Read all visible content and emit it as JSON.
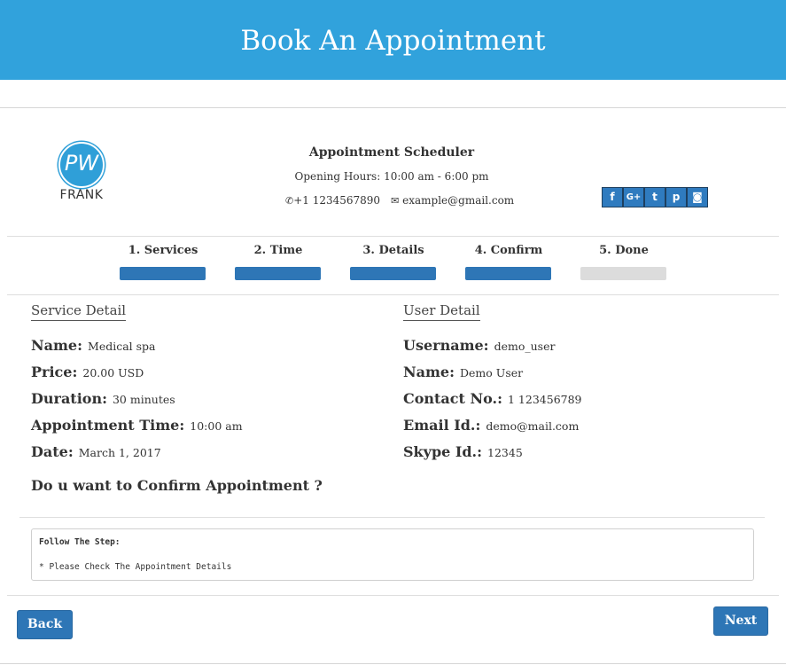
{
  "header": {
    "title": "Book An Appointment"
  },
  "business": {
    "logo_letters": "PW",
    "logo_text": "FRANK",
    "title": "Appointment Scheduler",
    "hours": "Opening Hours: 10:00 am - 6:00 pm",
    "phone": "+1 1234567890",
    "email": "example@gmail.com",
    "social": [
      "facebook-icon",
      "google-plus-icon",
      "twitter-icon",
      "pinterest-icon",
      "instagram-icon"
    ],
    "social_glyphs": {
      "facebook": "f",
      "google": "G+",
      "twitter": "t",
      "pinterest": "p",
      "instagram": "◙"
    }
  },
  "steps": [
    {
      "label": "1. Services",
      "complete": true
    },
    {
      "label": "2. Time",
      "complete": true
    },
    {
      "label": "3. Details",
      "complete": true
    },
    {
      "label": "4. Confirm",
      "complete": true
    },
    {
      "label": "5. Done",
      "complete": false
    }
  ],
  "service_detail": {
    "heading": "Service Detail",
    "name_label": "Name:",
    "name": "Medical spa",
    "price_label": "Price:",
    "price": "20.00 USD",
    "duration_label": "Duration:",
    "duration": "30 minutes",
    "time_label": "Appointment Time:",
    "time": "10:00 am",
    "date_label": "Date:",
    "date": "March 1, 2017"
  },
  "user_detail": {
    "heading": "User Detail",
    "username_label": "Username:",
    "username": "demo_user",
    "name_label": "Name:",
    "name": "Demo User",
    "contact_label": "Contact No.:",
    "contact": "1 123456789",
    "email_label": "Email Id.:",
    "email": "demo@mail.com",
    "skype_label": "Skype Id.:",
    "skype": "12345"
  },
  "confirm_question": "Do u want to Confirm Appointment ?",
  "instructions": {
    "title": "Follow The Step:",
    "line1": "* Please Check The Appointment Details"
  },
  "buttons": {
    "back": "Back",
    "next": "Next"
  },
  "colors": {
    "banner": "#31a2dc",
    "accent": "#2e76b6",
    "pending": "#dcdcdc"
  }
}
